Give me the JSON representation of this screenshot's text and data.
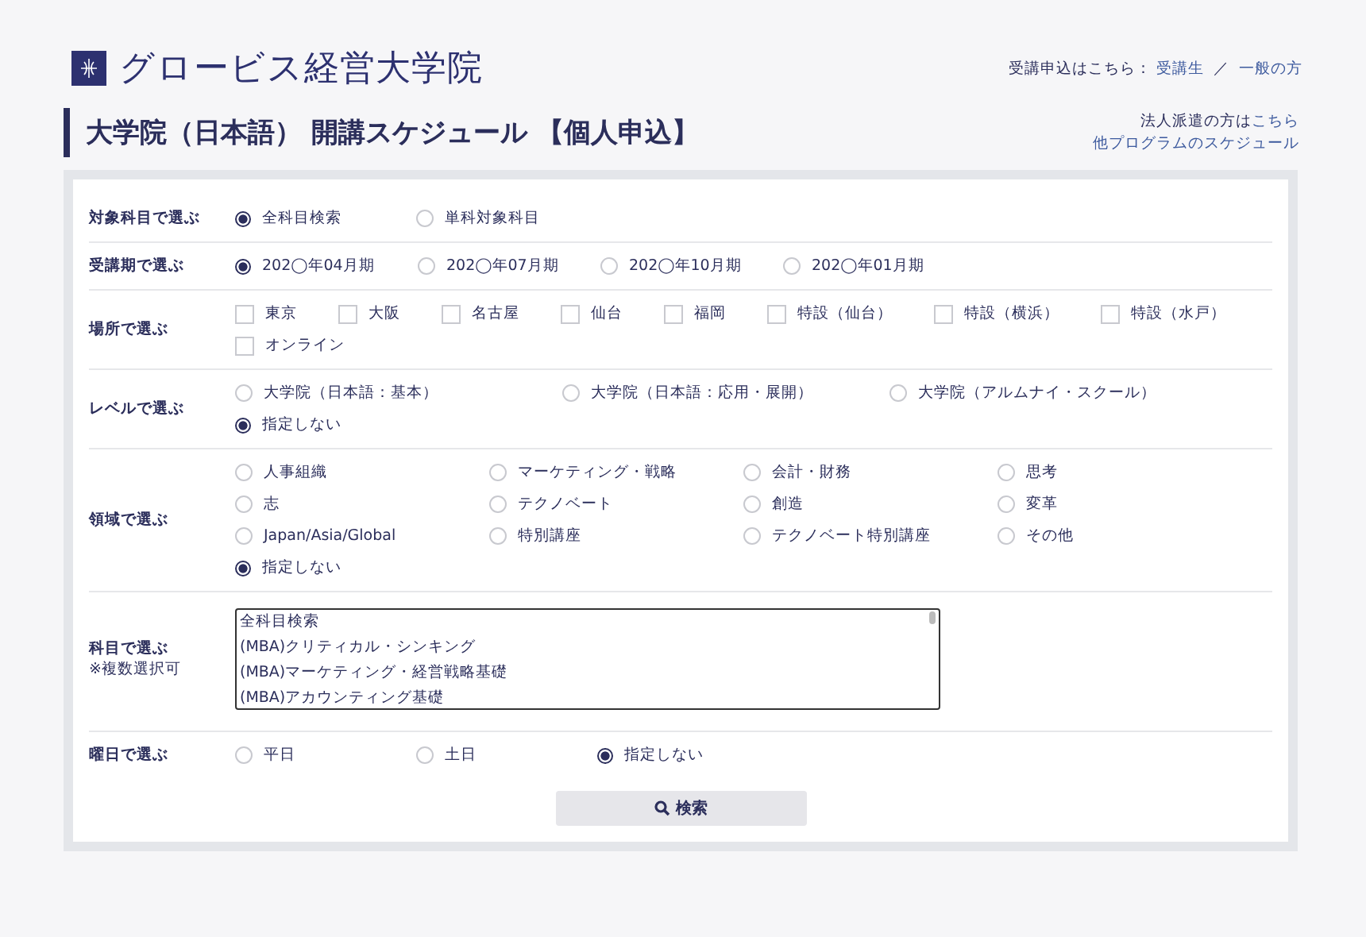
{
  "header": {
    "logo": "グロービス経営大学院",
    "apply_prompt": "受講申込はこちら：",
    "apply_links": [
      "受講生",
      "一般の方"
    ],
    "separator": "／",
    "corporate_text": "法人派遣の方は",
    "corporate_link": "こちら",
    "other_link": "他プログラムのスケジュール"
  },
  "page_title": "大学院（日本語） 開講スケジュール 【個人申込】",
  "filters": [
    {
      "label": "対象科目で選ぶ",
      "kind": "radio",
      "options": [
        {
          "label": "全科目検索",
          "selected": true
        },
        {
          "label": "単科対象科目",
          "selected": false
        }
      ]
    },
    {
      "label": "受講期で選ぶ",
      "kind": "radio",
      "options": [
        {
          "label": "202◯年04月期",
          "selected": true
        },
        {
          "label": "202◯年07月期",
          "selected": false
        },
        {
          "label": "202◯年10月期",
          "selected": false
        },
        {
          "label": "202◯年01月期",
          "selected": false
        }
      ]
    },
    {
      "label": "場所で選ぶ",
      "kind": "checkbox",
      "options": [
        {
          "label": "東京",
          "checked": false
        },
        {
          "label": "大阪",
          "checked": false
        },
        {
          "label": "名古屋",
          "checked": false
        },
        {
          "label": "仙台",
          "checked": false
        },
        {
          "label": "福岡",
          "checked": false
        },
        {
          "label": "特設（仙台）",
          "checked": false
        },
        {
          "label": "特設（横浜）",
          "checked": false
        },
        {
          "label": "特設（水戸）",
          "checked": false
        },
        {
          "label": "オンライン",
          "checked": false
        }
      ]
    },
    {
      "label": "レベルで選ぶ",
      "kind": "radio",
      "options": [
        {
          "label": "大学院（日本語：基本）",
          "selected": false
        },
        {
          "label": "大学院（日本語：応用・展開）",
          "selected": false
        },
        {
          "label": "大学院（アルムナイ・スクール）",
          "selected": false
        },
        {
          "label": "指定しない",
          "selected": true
        }
      ]
    },
    {
      "label": "領域で選ぶ",
      "kind": "radio",
      "options": [
        {
          "label": "人事組織",
          "selected": false
        },
        {
          "label": "マーケティング・戦略",
          "selected": false
        },
        {
          "label": "会計・財務",
          "selected": false
        },
        {
          "label": "思考",
          "selected": false
        },
        {
          "label": "志",
          "selected": false
        },
        {
          "label": "テクノベート",
          "selected": false
        },
        {
          "label": "創造",
          "selected": false
        },
        {
          "label": "変革",
          "selected": false
        },
        {
          "label": "Japan/Asia/Global",
          "selected": false
        },
        {
          "label": "特別講座",
          "selected": false
        },
        {
          "label": "テクノベート特別講座",
          "selected": false
        },
        {
          "label": "その他",
          "selected": false
        },
        {
          "label": "指定しない",
          "selected": true
        }
      ]
    },
    {
      "label": "科目で選ぶ",
      "note": "※複数選択可",
      "kind": "listbox",
      "items": [
        "全科目検索",
        "(MBA)クリティカル・シンキング",
        "(MBA)マーケティング・経営戦略基礎",
        "(MBA)アカウンティング基礎"
      ]
    },
    {
      "label": "曜日で選ぶ",
      "kind": "radio",
      "options": [
        {
          "label": "平日",
          "selected": false
        },
        {
          "label": "土日",
          "selected": false
        },
        {
          "label": "指定しない",
          "selected": true
        }
      ]
    }
  ],
  "search_button": "検索"
}
